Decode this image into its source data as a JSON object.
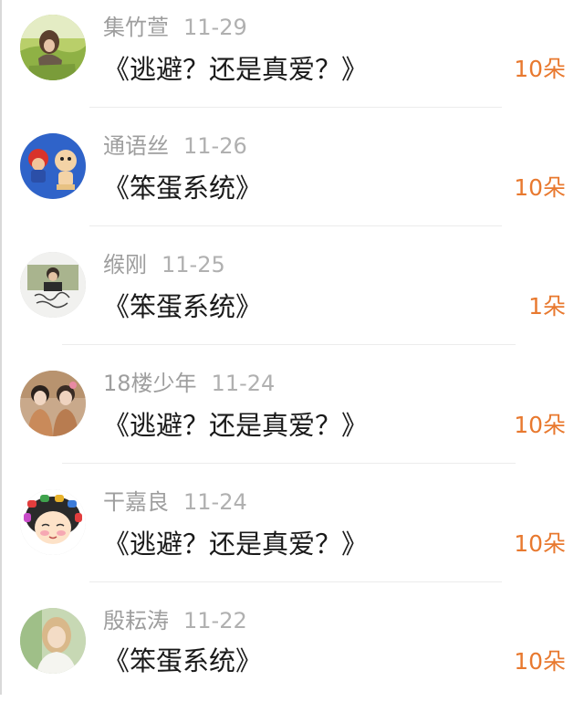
{
  "gifts": [
    {
      "name": "集竹萱",
      "date": "11-29",
      "title": "《逃避？还是真爱？》",
      "count": "10朵",
      "avatar_icon": "girl-in-grass-photo-icon"
    },
    {
      "name": "通语丝",
      "date": "11-26",
      "title": "《笨蛋系统》",
      "count": "10朵",
      "avatar_icon": "cartoon-characters-icon"
    },
    {
      "name": "缑刚",
      "date": "11-25",
      "title": "《笨蛋系统》",
      "count": "1朵",
      "avatar_icon": "boy-photo-with-signature-icon"
    },
    {
      "name": "18楼少年",
      "date": "11-24",
      "title": "《逃避？还是真爱？》",
      "count": "10朵",
      "avatar_icon": "two-boys-photo-icon"
    },
    {
      "name": "干嘉良",
      "date": "11-24",
      "title": "《逃避？还是真爱？》",
      "count": "10朵",
      "avatar_icon": "cartoon-girl-hair-curlers-icon"
    },
    {
      "name": "殷耘涛",
      "date": "11-22",
      "title": "《笨蛋系统》",
      "count": "10朵",
      "avatar_icon": "girl-portrait-photo-icon"
    }
  ],
  "colors": {
    "count_accent": "#e8792f",
    "meta_gray": "#9e9e9e",
    "title_text": "#1a1a1a",
    "divider": "#ececec"
  }
}
